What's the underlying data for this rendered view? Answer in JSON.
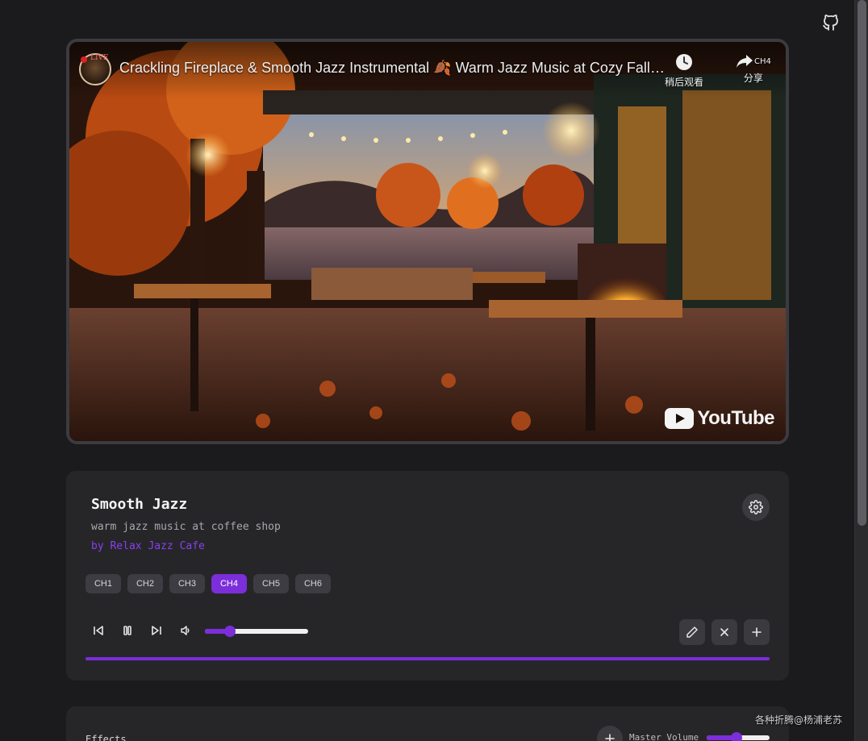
{
  "video": {
    "title": "Crackling Fireplace & Smooth Jazz Instrumental 🍂 Warm Jazz Music at Cozy Fall Coffee Shop Ambience",
    "live_badge": "LIVE",
    "watch_later_label": "稍后观看",
    "share_label": "分享",
    "share_channel": "CH4",
    "logo_text": "YouTube"
  },
  "track": {
    "title": "Smooth Jazz",
    "description": "warm jazz music at coffee shop",
    "artist": "by Relax Jazz Cafe"
  },
  "channels": [
    {
      "label": "CH1",
      "active": false
    },
    {
      "label": "CH2",
      "active": false
    },
    {
      "label": "CH3",
      "active": false
    },
    {
      "label": "CH4",
      "active": true
    },
    {
      "label": "CH5",
      "active": false
    },
    {
      "label": "CH6",
      "active": false
    }
  ],
  "volume": 0.24,
  "progress": 1.0,
  "effects": {
    "label": "Effects",
    "master_volume_label": "Master Volume",
    "master_volume": 0.48
  },
  "watermark": "各种折腾@杨浦老苏",
  "colors": {
    "accent": "#7b2ed9",
    "card": "#262629",
    "background": "#1b1b1e"
  }
}
